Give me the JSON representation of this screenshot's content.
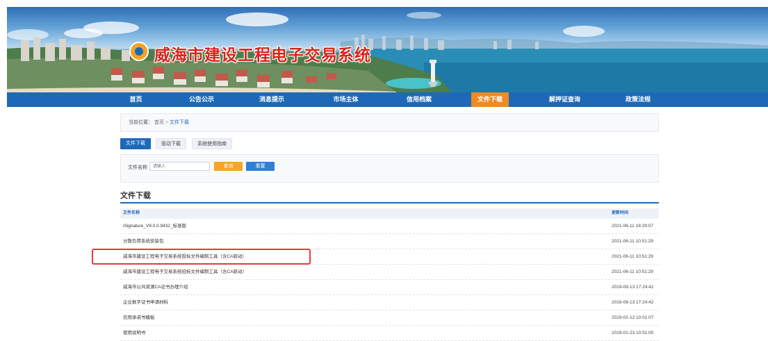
{
  "site": {
    "title": "威海市建设工程电子交易系统",
    "logo_icon": "shield-logo-icon"
  },
  "nav": {
    "items": [
      "首页",
      "公告公示",
      "消息提示",
      "市场主体",
      "信用档案",
      "文件下载",
      "解押证查询",
      "政策法规"
    ],
    "active": "文件下载"
  },
  "breadcrumb": {
    "prefix": "当前位置：",
    "home": "首页",
    "separator": ">",
    "current": "文件下载"
  },
  "tabs": [
    "文件下载",
    "驱动下载",
    "系统使用指南"
  ],
  "search": {
    "label": "文件名称",
    "placeholder": "请输入",
    "search_button": "查询",
    "reset_button": "重置"
  },
  "section": {
    "title": "文件下载"
  },
  "table": {
    "headers": {
      "name": "文件名称",
      "time": "更新时间"
    },
    "rows": [
      {
        "name": "iSignature_V9.0.0.9432_标准版",
        "time": "2021-06-11 18:29:07"
      },
      {
        "name": "分散负荷系统安装包",
        "time": "2021-06-11 10:51:29"
      },
      {
        "name": "威海市建设工程电子交易系统投标文件编制工具（含CA驱动）",
        "time": "2021-06-11 10:51:29"
      },
      {
        "name": "威海市建设工程电子交易系统招标文件编制工具（含CA驱动）",
        "time": "2021-06-11 10:51:29"
      },
      {
        "name": "威海市公共资源CA证书办理介绍",
        "time": "2019-08-13 17:24:42"
      },
      {
        "name": "企业数字证书申请材料",
        "time": "2019-08-13 17:24:42"
      },
      {
        "name": "信用承诺书模板",
        "time": "2019-02-12 10:01:07"
      },
      {
        "name": "使用说明书",
        "time": "2019-01-23 10:51:00"
      }
    ]
  },
  "colors": {
    "primary": "#1d69b8",
    "active_tab": "#f08a23",
    "search_button": "#f5a623",
    "highlight": "#e53b3b",
    "title": "#d8241a"
  }
}
